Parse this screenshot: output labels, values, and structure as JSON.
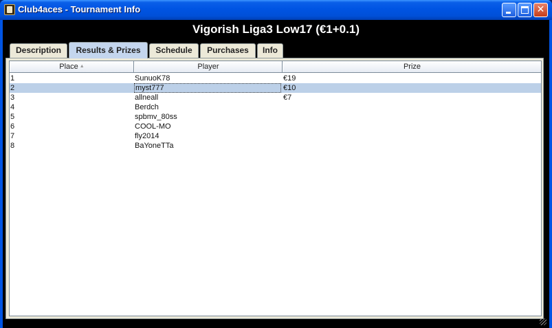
{
  "window": {
    "title": "Club4aces - Tournament Info",
    "controls": {
      "minimize": "minimize",
      "maximize": "maximize",
      "close": "✕"
    }
  },
  "heading": "Vigorish Liga3 Low17 (€1+0.1)",
  "tabs": [
    {
      "label": "Description",
      "active": false
    },
    {
      "label": "Results & Prizes",
      "active": true
    },
    {
      "label": "Schedule",
      "active": false
    },
    {
      "label": "Purchases",
      "active": false
    },
    {
      "label": "Info",
      "active": false
    }
  ],
  "table": {
    "columns": [
      "Place",
      "Player",
      "Prize"
    ],
    "sort_column": "Place",
    "sort_direction": "ascending",
    "selected_row": 1,
    "rows": [
      {
        "place": "1",
        "player": "SunuoK78",
        "prize": "€19"
      },
      {
        "place": "2",
        "player": "myst777",
        "prize": "€10"
      },
      {
        "place": "3",
        "player": "allneall",
        "prize": "€7"
      },
      {
        "place": "4",
        "player": "Berdch",
        "prize": ""
      },
      {
        "place": "5",
        "player": "spbmv_80ss",
        "prize": ""
      },
      {
        "place": "6",
        "player": "COOL-MO",
        "prize": ""
      },
      {
        "place": "7",
        "player": "fly2014",
        "prize": ""
      },
      {
        "place": "8",
        "player": "BaYoneTTa",
        "prize": ""
      }
    ]
  },
  "colors": {
    "titlebar": "#0054e3",
    "selection": "#bcd0e8",
    "active_tab": "#c4d6ee"
  }
}
